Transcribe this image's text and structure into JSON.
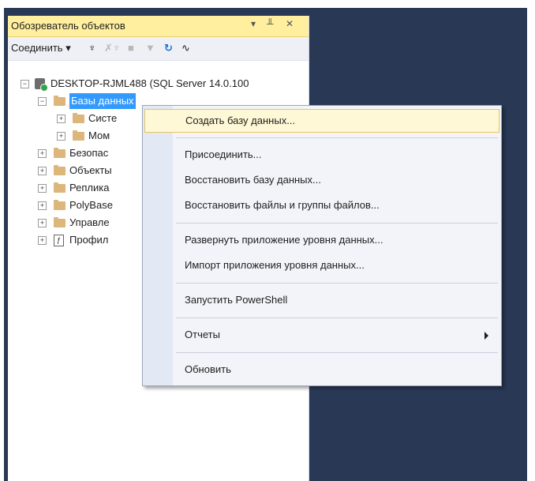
{
  "panel": {
    "title": "Обозреватель объектов",
    "pin_glyph": "▾ ╨ ✕"
  },
  "toolbar": {
    "connect_label": "Соединить ▾",
    "icons": [
      "plug-icon",
      "disconnect-icon",
      "stop-icon",
      "filter-icon",
      "refresh-icon",
      "activity-icon"
    ]
  },
  "tree": {
    "server": "DESKTOP-RJML488 (SQL Server 14.0.100",
    "databases": "Базы данных",
    "system": "Систе",
    "snapshots": "Мом",
    "security": "Безопас",
    "objects": "Объекты",
    "replication": "Реплика",
    "polybase": "PolyBase",
    "management": "Управле",
    "profiler": "Профил"
  },
  "context_menu": {
    "items": [
      "Создать базу данных...",
      "Присоединить...",
      "Восстановить базу данных...",
      "Восстановить файлы и группы файлов...",
      "Развернуть приложение уровня данных...",
      "Импорт приложения уровня данных...",
      "Запустить PowerShell",
      "Отчеты",
      "Обновить"
    ],
    "hover_index": 0
  },
  "colors": {
    "title_bar": "#ffef9f",
    "selection": "#3399ff",
    "frame": "#293955",
    "folder": "#dcb67a"
  }
}
